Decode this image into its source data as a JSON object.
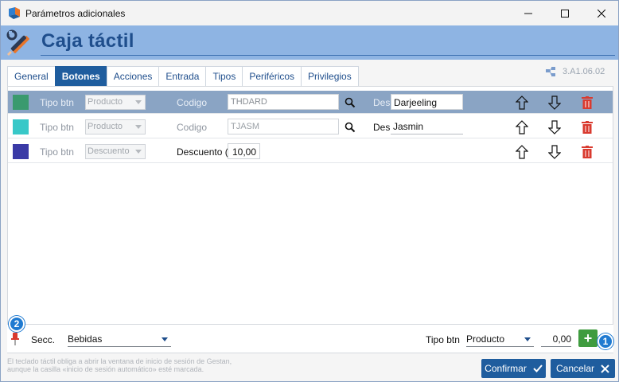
{
  "window": {
    "title": "Parámetros adicionales"
  },
  "header": {
    "title": "Caja táctil"
  },
  "tabs": [
    {
      "label": "General",
      "active": false
    },
    {
      "label": "Botones",
      "active": true
    },
    {
      "label": "Acciones",
      "active": false
    },
    {
      "label": "Entrada",
      "active": false
    },
    {
      "label": "Tipos",
      "active": false
    },
    {
      "label": "Periféricos",
      "active": false
    },
    {
      "label": "Privilegios",
      "active": false
    }
  ],
  "version": "3.A1.06.02",
  "rows": [
    {
      "color": "#3a9a6e",
      "tipo_label": "Tipo btn",
      "tipo_value": "Producto",
      "code_label": "Codigo",
      "code_value": "THDARD",
      "des_label": "Des",
      "des_value": "Darjeeling",
      "selected": true
    },
    {
      "color": "#38c8c8",
      "tipo_label": "Tipo btn",
      "tipo_value": "Producto",
      "code_label": "Codigo",
      "code_value": "TJASM",
      "des_label": "Des",
      "des_value": "Jasmin",
      "selected": false
    },
    {
      "color": "#3a3aa6",
      "tipo_label": "Tipo btn",
      "tipo_value": "Descuento",
      "discount_label": "Descuento (%",
      "discount_value": "10,00",
      "selected": false
    }
  ],
  "bottom": {
    "badge_left": "2",
    "secc_label": "Secc.",
    "secc_value": "Bebidas",
    "tipo_label": "Tipo btn",
    "tipo_value": "Producto",
    "amount": "0,00",
    "add_label": "+",
    "badge_right": "1"
  },
  "footer": {
    "note": "El teclado táctil obliga a abrir la ventana de inicio de sesión de Gestan, aunque la casilla «inicio de sesión automático» esté marcada.",
    "confirm_label": "Confirmar",
    "cancel_label": "Cancelar"
  },
  "colors": {
    "accent": "#1f5d9e",
    "header_bg": "#8eb4e3",
    "selected_row": "#8aa4c4",
    "delete": "#d93a2f",
    "add": "#3f9c3f"
  }
}
